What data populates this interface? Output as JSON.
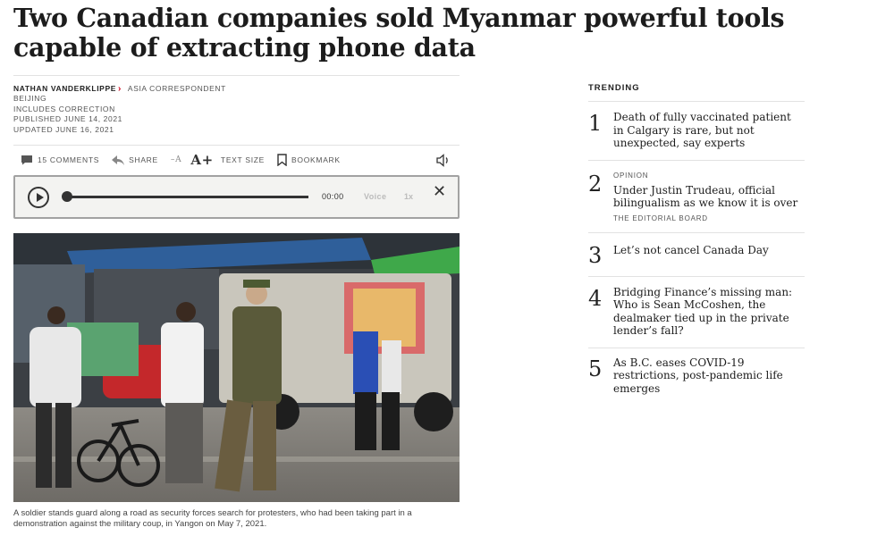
{
  "article": {
    "headline": "Two Canadian companies sold Myanmar powerful tools capable of extracting phone data",
    "author": "NATHAN VANDERKLIPPE",
    "author_role": "ASIA CORRESPONDENT",
    "location": "BEIJING",
    "correction": "INCLUDES CORRECTION",
    "published": "PUBLISHED JUNE 14, 2021",
    "updated": "UPDATED JUNE 16, 2021"
  },
  "toolbar": {
    "comments": "15 COMMENTS",
    "share": "SHARE",
    "text_size_small": "–A",
    "text_size_large": "A+",
    "text_size": "TEXT SIZE",
    "bookmark": "BOOKMARK"
  },
  "audio_player": {
    "time": "00:00",
    "voice": "Voice",
    "speed": "1x",
    "progress": 0
  },
  "photo": {
    "caption": "A soldier stands guard along a road as security forces search for protesters, who had been taking part in a demonstration against the military coup, in Yangon on May 7, 2021."
  },
  "trending": {
    "title": "TRENDING",
    "items": [
      {
        "num": "1",
        "kicker": "",
        "headline": "Death of fully vaccinated patient in Calgary is rare, but not unexpected, say experts",
        "author": ""
      },
      {
        "num": "2",
        "kicker": "OPINION",
        "headline": "Under Justin Trudeau, official bilingualism as we know it is over",
        "author": "THE EDITORIAL BOARD"
      },
      {
        "num": "3",
        "kicker": "",
        "headline": "Let’s not cancel Canada Day",
        "author": ""
      },
      {
        "num": "4",
        "kicker": "",
        "headline": "Bridging Finance’s missing man: Who is Sean McCoshen, the dealmaker tied up in the private lender’s fall?",
        "author": ""
      },
      {
        "num": "5",
        "kicker": "",
        "headline": "As B.C. eases COVID-19 restrictions, post-pandemic life emerges",
        "author": ""
      }
    ]
  }
}
